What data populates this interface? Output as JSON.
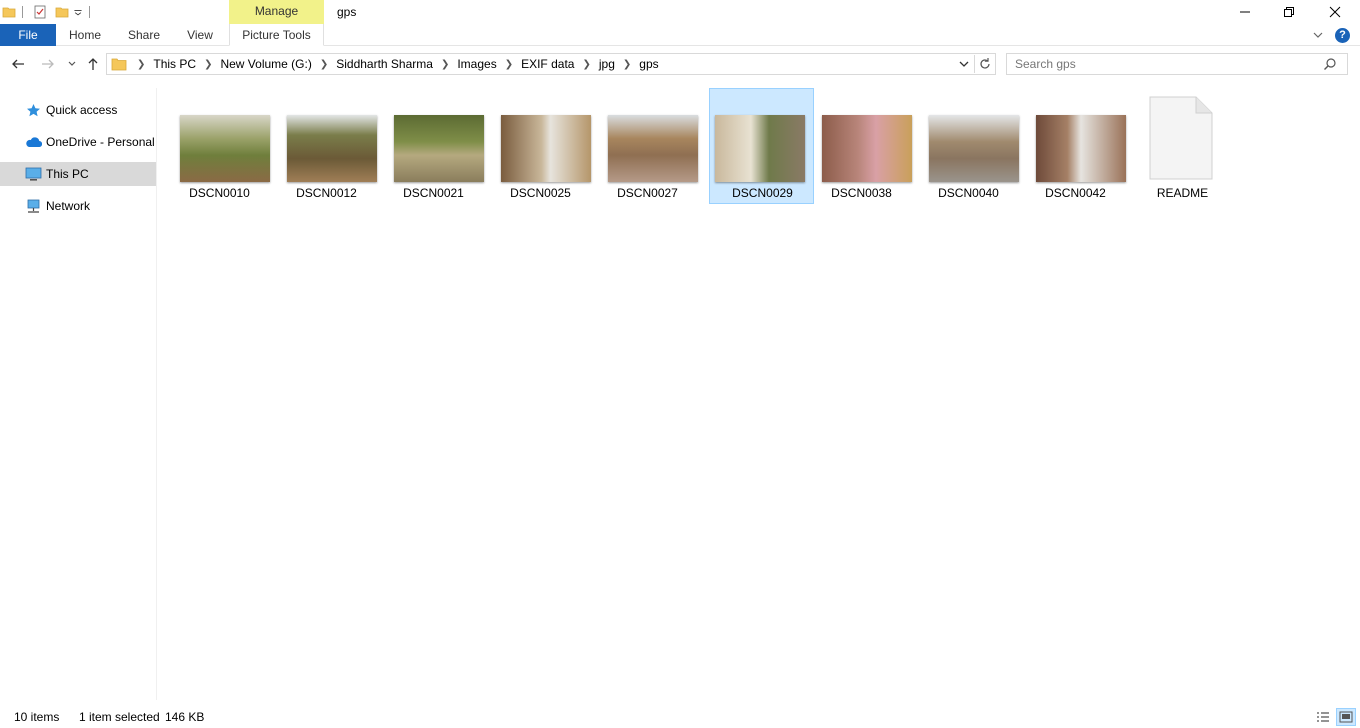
{
  "window": {
    "title": "gps",
    "contextual_group": "Manage"
  },
  "ribbon": {
    "tabs": [
      {
        "label": "File"
      },
      {
        "label": "Home"
      },
      {
        "label": "Share"
      },
      {
        "label": "View"
      },
      {
        "label": "Picture Tools"
      }
    ]
  },
  "breadcrumb": [
    "This PC",
    "New Volume (G:)",
    "Siddharth Sharma",
    "Images",
    "EXIF data",
    "jpg",
    "gps"
  ],
  "search": {
    "placeholder": "Search gps"
  },
  "navpane": {
    "items": [
      {
        "label": "Quick access",
        "icon": "star-icon"
      },
      {
        "label": "OneDrive - Personal",
        "icon": "cloud-icon"
      },
      {
        "label": "This PC",
        "icon": "computer-icon",
        "selected": true
      },
      {
        "label": "Network",
        "icon": "network-icon"
      }
    ]
  },
  "files": [
    {
      "name": "DSCN0010",
      "kind": "image"
    },
    {
      "name": "DSCN0012",
      "kind": "image"
    },
    {
      "name": "DSCN0021",
      "kind": "image"
    },
    {
      "name": "DSCN0025",
      "kind": "image"
    },
    {
      "name": "DSCN0027",
      "kind": "image"
    },
    {
      "name": "DSCN0029",
      "kind": "image",
      "selected": true
    },
    {
      "name": "DSCN0038",
      "kind": "image"
    },
    {
      "name": "DSCN0040",
      "kind": "image"
    },
    {
      "name": "DSCN0042",
      "kind": "image"
    },
    {
      "name": "README",
      "kind": "document"
    }
  ],
  "status": {
    "item_count": "10 items",
    "selection": "1 item selected",
    "size": "146 KB"
  },
  "colors": {
    "accent": "#1a63b8",
    "manage_highlight": "#f2f28a",
    "selection_bg": "#cce8ff",
    "selection_border": "#99d1ff"
  }
}
